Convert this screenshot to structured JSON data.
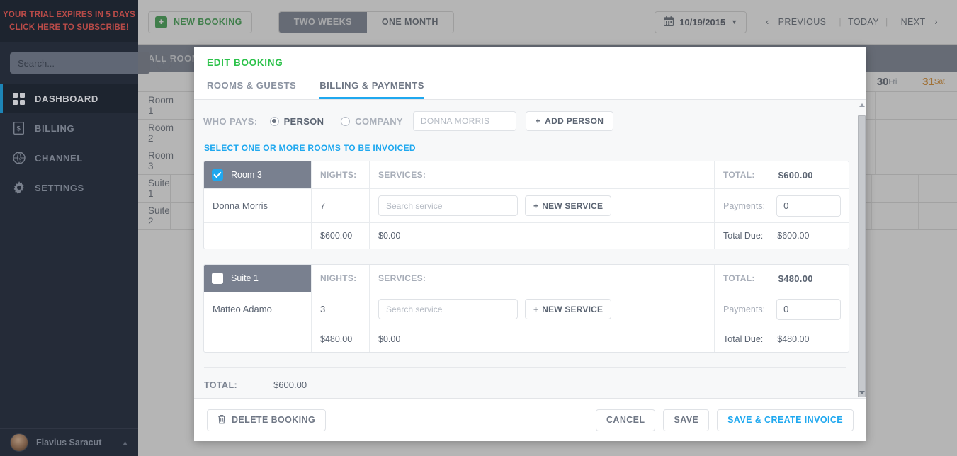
{
  "sidebar": {
    "trial": {
      "line1": "YOUR TRIAL EXPIRES IN 5 DAYS",
      "line2": "CLICK HERE TO SUBSCRIBE!"
    },
    "search_placeholder": "Search...",
    "collapse_icon": "chevron-left-icon",
    "items": [
      {
        "label": "DASHBOARD",
        "icon": "grid-icon",
        "active": true
      },
      {
        "label": "BILLING",
        "icon": "invoice-icon",
        "active": false
      },
      {
        "label": "CHANNEL",
        "icon": "globe-cursor-icon",
        "active": false
      },
      {
        "label": "SETTINGS",
        "icon": "gear-icon",
        "active": false
      }
    ],
    "user": {
      "name": "Flavius Saracut",
      "caret": "▲"
    }
  },
  "topbar": {
    "new_booking": "NEW BOOKING",
    "range": {
      "two_weeks": "TWO WEEKS",
      "one_month": "ONE MONTH",
      "selected": "TWO WEEKS"
    },
    "date_value": "10/19/2015",
    "calendar_icon": "calendar-icon",
    "nav": {
      "previous": "PREVIOUS",
      "today": "TODAY",
      "next": "NEXT"
    }
  },
  "calendar": {
    "all_rooms": "ALL ROOMS",
    "dates": [
      {
        "day": "30",
        "dow": "Fri",
        "weekend": false
      },
      {
        "day": "31",
        "dow": "Sat",
        "weekend": true
      }
    ],
    "rooms": [
      "Room 1",
      "Room 2",
      "Room 3",
      "Suite 1",
      "Suite 2"
    ]
  },
  "modal": {
    "title": "EDIT BOOKING",
    "tabs": [
      {
        "label": "ROOMS & GUESTS",
        "active": false
      },
      {
        "label": "BILLING & PAYMENTS",
        "active": true
      }
    ],
    "who_pays": {
      "label": "WHO PAYS:",
      "person": "PERSON",
      "company": "COMPANY",
      "selected": "PERSON",
      "person_placeholder": "DONNA MORRIS",
      "person_value": "",
      "add_person": "ADD PERSON"
    },
    "select_hint": "SELECT ONE OR MORE ROOMS TO BE INVOICED",
    "col_headers": {
      "nights": "NIGHTS:",
      "services": "SERVICES:",
      "total": "TOTAL:"
    },
    "labels": {
      "payments": "Payments:",
      "total_due": "Total Due:",
      "search_service_placeholder": "Search service",
      "new_service": "NEW SERVICE"
    },
    "rooms": [
      {
        "room": "Room 3",
        "checked": true,
        "total": "$600.00",
        "guest": "Donna Morris",
        "nights": "7",
        "service_value": "",
        "payments_value": "0",
        "nights_amount": "$600.00",
        "services_amount": "$0.00",
        "total_due": "$600.00"
      },
      {
        "room": "Suite 1",
        "checked": false,
        "total": "$480.00",
        "guest": "Matteo Adamo",
        "nights": "3",
        "service_value": "",
        "payments_value": "0",
        "nights_amount": "$480.00",
        "services_amount": "$0.00",
        "total_due": "$480.00"
      }
    ],
    "grand_total": {
      "label": "TOTAL:",
      "value": "$600.00"
    },
    "footer": {
      "delete": "DELETE BOOKING",
      "delete_icon": "trash-icon",
      "cancel": "CANCEL",
      "save": "SAVE",
      "save_invoice": "SAVE & CREATE INVOICE"
    }
  },
  "colors": {
    "accent_blue": "#1fa8ef",
    "green": "#2cc24a",
    "sidebar_bg": "#242c3b",
    "trial_red": "#d9534f",
    "weekend_orange": "#d98318"
  }
}
